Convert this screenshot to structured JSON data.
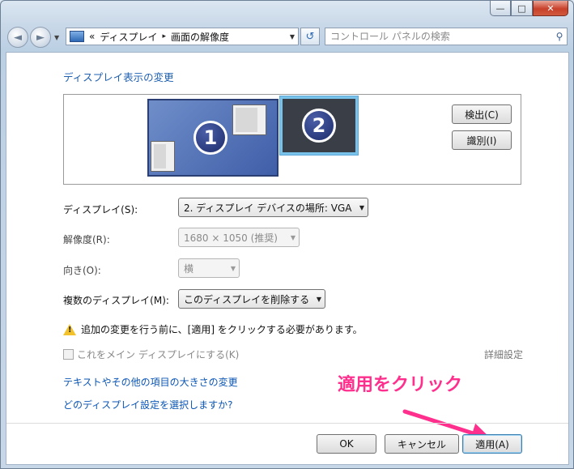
{
  "window": {
    "caption_buttons": {
      "minimize": "—",
      "maximize": "□",
      "close": "✕"
    }
  },
  "toolbar": {
    "back_glyph": "◄",
    "forward_glyph": "►",
    "address": {
      "overflow": "«",
      "segments": [
        "ディスプレイ",
        "画面の解像度"
      ],
      "separator": "▸"
    },
    "refresh_glyph": "↺",
    "search_placeholder": "コントロール パネルの検索"
  },
  "main": {
    "heading": "ディスプレイ表示の変更",
    "monitors": [
      {
        "number": "1",
        "selected": false
      },
      {
        "number": "2",
        "selected": true
      }
    ],
    "detect_button": "検出(C)",
    "identify_button": "識別(I)",
    "display_label": "ディスプレイ(S):",
    "display_value": "2. ディスプレイ デバイスの場所: VGA",
    "resolution_label": "解像度(R):",
    "resolution_value": "1680 × 1050 (推奨)",
    "orientation_label": "向き(O):",
    "orientation_value": "横",
    "multi_label": "複数のディスプレイ(M):",
    "multi_value": "このディスプレイを削除する",
    "warning_text": "追加の変更を行う前に、[適用] をクリックする必要があります。",
    "main_display_checkbox": "これをメイン ディスプレイにする(K)",
    "advanced_settings": "詳細設定",
    "link_text_size": "テキストやその他の項目の大きさの変更",
    "link_which_settings": "どのディスプレイ設定を選択しますか?"
  },
  "annotation": {
    "text": "適用をクリック",
    "color": "#ff2f8d"
  },
  "footer": {
    "ok": "OK",
    "cancel": "キャンセル",
    "apply": "適用(A)"
  },
  "colors": {
    "link": "#0b56b5",
    "selected_monitor_border": "#79c3ea",
    "warning": "#f3c22b"
  }
}
